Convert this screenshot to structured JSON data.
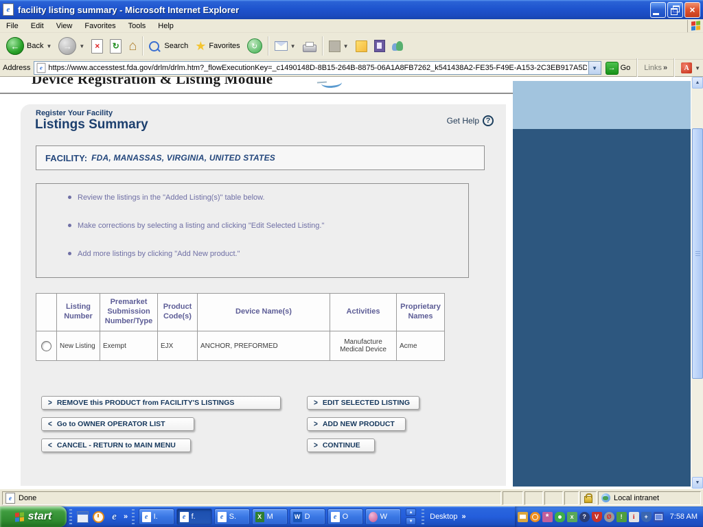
{
  "window": {
    "title": "facility listing summary - Microsoft Internet Explorer"
  },
  "menu": {
    "items": [
      "File",
      "Edit",
      "View",
      "Favorites",
      "Tools",
      "Help"
    ]
  },
  "toolbar": {
    "back_label": "Back",
    "search_label": "Search",
    "favorites_label": "Favorites"
  },
  "address": {
    "label": "Address",
    "url": "https://www.accesstest.fda.gov/drlm/drlm.htm?_flowExecutionKey=_c1490148D-8B15-264B-8875-06A1A8FB7262_k541438A2-FE35-F49E-A153-2C3EB917A5D",
    "go_label": "Go",
    "links_label": "Links"
  },
  "page": {
    "header_title": "Device Registration & Listing Module",
    "breadcrumb": "Register Your Facility",
    "title": "Listings Summary",
    "get_help_label": "Get Help",
    "facility_label": "FACILITY:",
    "facility_value": "FDA, MANASSAS, VIRGINIA, UNITED STATES",
    "instructions": [
      "Review the listings in the \"Added Listing(s)\" table below.",
      "Make corrections by selecting a listing and clicking \"Edit Selected Listing.\"",
      "Add more listings by clicking \"Add New product.\""
    ],
    "table": {
      "headers": [
        "Listing Number",
        "Premarket Submission Number/Type",
        "Product Code(s)",
        "Device Name(s)",
        "Activities",
        "Proprietary Names"
      ],
      "rows": [
        {
          "listing_number": "New Listing",
          "premarket": "Exempt",
          "product_code": "EJX",
          "device_names": "ANCHOR, PREFORMED",
          "activities": "Manufacture Medical Device",
          "proprietary": "Acme"
        }
      ]
    },
    "buttons_left": [
      {
        "chevron": ">",
        "label": "REMOVE this PRODUCT from FACILITY'S LISTINGS"
      },
      {
        "chevron": "<",
        "label": "Go to OWNER OPERATOR LIST"
      },
      {
        "chevron": "<",
        "label": "CANCEL - RETURN to MAIN MENU"
      }
    ],
    "buttons_right": [
      {
        "chevron": ">",
        "label": "EDIT SELECTED LISTING"
      },
      {
        "chevron": ">",
        "label": "ADD NEW PRODUCT"
      },
      {
        "chevron": ">",
        "label": "CONTINUE"
      }
    ]
  },
  "status": {
    "text": "Done",
    "zone": "Local intranet"
  },
  "taskbar": {
    "start_label": "start",
    "tasks": [
      {
        "label": "I."
      },
      {
        "label": "f."
      },
      {
        "label": "S."
      },
      {
        "label": "M"
      },
      {
        "label": "D"
      },
      {
        "label": "O"
      },
      {
        "label": "W"
      }
    ],
    "desktop_label": "Desktop",
    "clock": "7:58 AM"
  },
  "colors": {
    "titlebar_blue": "#1e54ce",
    "taskbar_blue": "#245edb",
    "start_green": "#3f9c3f",
    "heading_navy": "#1c3f6e",
    "bullet_purple": "#6f6fa5",
    "panel_blue_dark": "#2d577f",
    "panel_blue_light": "#a2c4de",
    "go_green": "#179117"
  }
}
